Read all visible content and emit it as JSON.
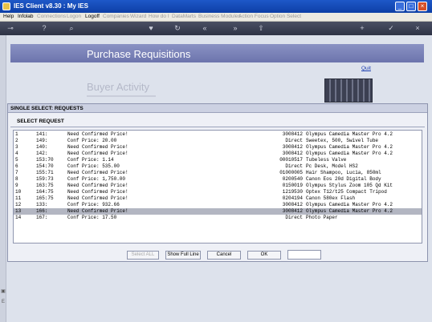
{
  "window": {
    "title": "IES Client v8.30 : My IES"
  },
  "menu": [
    {
      "label": "Help",
      "enabled": true
    },
    {
      "label": "Infolab",
      "enabled": true
    },
    {
      "label": "Connections",
      "enabled": false
    },
    {
      "label": "Logon",
      "enabled": false
    },
    {
      "label": "Logoff",
      "enabled": true
    },
    {
      "label": "Companies",
      "enabled": false
    },
    {
      "label": "Wizard",
      "enabled": false
    },
    {
      "label": "How do I",
      "enabled": false
    },
    {
      "label": "DataMarts",
      "enabled": false
    },
    {
      "label": "Business Modules",
      "enabled": false
    },
    {
      "label": "Action Focus",
      "enabled": false
    },
    {
      "label": "Option Select",
      "enabled": false
    }
  ],
  "toolbar_icons": [
    "key-icon",
    "help-icon",
    "search-icon",
    "heart-icon",
    "refresh-icon",
    "back-icon",
    "forward-icon",
    "upload-icon",
    "add-icon",
    "check-icon",
    "close-icon"
  ],
  "page": {
    "banner_title": "Purchase Requisitions",
    "quit_label": "Quit",
    "section_title": "Buyer Activity"
  },
  "dialog": {
    "title": "SINGLE SELECT: REQUESTS",
    "subtitle": "SELECT REQUEST",
    "rows": [
      {
        "idx": "1",
        "code": "141:",
        "status": "Need Confirmed Price!",
        "part": "3008412",
        "desc": "Olympus Camedia Master Pro 4.2"
      },
      {
        "idx": "2",
        "code": "149:",
        "status": "Conf Price: 20.00",
        "part": "Direct",
        "desc": "Sweetex, 500, Swivel Tube"
      },
      {
        "idx": "3",
        "code": "140:",
        "status": "Need Confirmed Price!",
        "part": "3008412",
        "desc": "Olympus Camedia Master Pro 4.2"
      },
      {
        "idx": "4",
        "code": "142:",
        "status": "Need Confirmed Price!",
        "part": "3008412",
        "desc": "Olympus Camedia Master Pro 4.2"
      },
      {
        "idx": "5",
        "code": "153:70",
        "status": "Conf Price: 1.14",
        "part": "00010517",
        "desc": "Tubeless Valve"
      },
      {
        "idx": "6",
        "code": "154:70",
        "status": "Conf Price: 535.00",
        "part": "Direct",
        "desc": "Pc Desk, Model HS2"
      },
      {
        "idx": "7",
        "code": "155:71",
        "status": "Need Confirmed Price!",
        "part": "01000005",
        "desc": "Hair Shampoo, Lucia, 850ml"
      },
      {
        "idx": "8",
        "code": "159:73",
        "status": "Conf Price: 1,750.00",
        "part": "0200540",
        "desc": "Canon Eos 20d Digital Body"
      },
      {
        "idx": "9",
        "code": "163:75",
        "status": "Need Confirmed Price!",
        "part": "0150019",
        "desc": "Olympus Stylus Zoom 105 Qd Kit"
      },
      {
        "idx": "10",
        "code": "164:75",
        "status": "Need Confirmed Price!",
        "part": "1219530",
        "desc": "Optex T12/t25 Compact Tripod"
      },
      {
        "idx": "11",
        "code": "165:75",
        "status": "Need Confirmed Price!",
        "part": "0204194",
        "desc": "Canon 580ex Flash"
      },
      {
        "idx": "12",
        "code": "133:",
        "status": "Conf Price: 932.66",
        "part": "3008412",
        "desc": "Olympus Camedia Master Pro 4.2"
      },
      {
        "idx": "13",
        "code": "166:",
        "status": "Need Confirmed Price!",
        "part": "3008412",
        "desc": "Olympus Camedia Master Pro 4.2"
      },
      {
        "idx": "14",
        "code": "167:",
        "status": "Conf Price: 17.50",
        "part": "Direct",
        "desc": "Photo Paper"
      }
    ],
    "selected_index": 12,
    "buttons": {
      "select_all": "Select ALL",
      "show_full_line": "Show Full Line",
      "cancel": "Cancel",
      "ok": "OK"
    },
    "input_value": ""
  }
}
